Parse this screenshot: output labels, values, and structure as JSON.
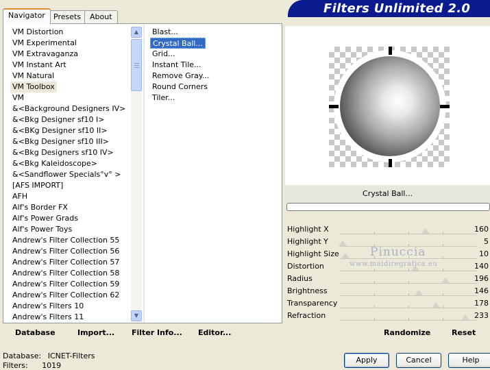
{
  "tabs": [
    "Navigator",
    "Presets",
    "About"
  ],
  "banner": {
    "title": "Filters Unlimited 2.0"
  },
  "categories": [
    "VM Distortion",
    "VM Experimental",
    "VM Extravaganza",
    "VM Instant Art",
    "VM Natural",
    "VM Toolbox",
    "VM",
    "&<Background Designers IV>",
    "&<Bkg Designer sf10 I>",
    "&<BKg Designer sf10 II>",
    "&<Bkg Designer sf10 III>",
    "&<Bkg Designers sf10 IV>",
    "&<Bkg Kaleidoscope>",
    "&<Sandflower Specials°v° >",
    "[AFS IMPORT]",
    "AFH",
    "Alf's Border FX",
    "Alf's Power Grads",
    "Alf's Power Toys",
    "Andrew's Filter Collection 55",
    "Andrew's Filter Collection 56",
    "Andrew's Filter Collection 57",
    "Andrew's Filter Collection 58",
    "Andrew's Filter Collection 59",
    "Andrew's Filter Collection 62",
    "Andrew's Filters 10",
    "Andrew's Filters 11"
  ],
  "filters": [
    "Blast...",
    "Crystal Ball...",
    "Grid...",
    "Instant Tile...",
    "Remove Gray...",
    "Round Corners",
    "Tiler..."
  ],
  "left_buttons": [
    "Database",
    "Import...",
    "Filter Info...",
    "Editor..."
  ],
  "preview": {
    "filter_name": "Crystal Ball..."
  },
  "params": [
    {
      "label": "Highlight X",
      "value": "160",
      "level": 0.627
    },
    {
      "label": "Highlight Y",
      "value": "5",
      "level": 0.02
    },
    {
      "label": "Highlight Size",
      "value": "10",
      "level": 0.04
    },
    {
      "label": "Distortion",
      "value": "140",
      "level": 0.549
    },
    {
      "label": "Radius",
      "value": "196",
      "level": 0.769
    },
    {
      "label": "Brightness",
      "value": "146",
      "level": 0.573
    },
    {
      "label": "Transparency",
      "value": "178",
      "level": 0.698
    },
    {
      "label": "Refraction",
      "value": "233",
      "level": 0.914
    }
  ],
  "right_buttons": {
    "randomize": "Randomize",
    "reset": "Reset"
  },
  "watermark": {
    "name": "Pinuccia",
    "url": "www.maidiregrafica.eu"
  },
  "status": {
    "database_label": "Database:",
    "database_value": "ICNET-Filters",
    "filters_label": "Filters:",
    "filters_value": "1019"
  },
  "dialog_buttons": {
    "apply": "Apply",
    "cancel": "Cancel",
    "help": "Help"
  }
}
